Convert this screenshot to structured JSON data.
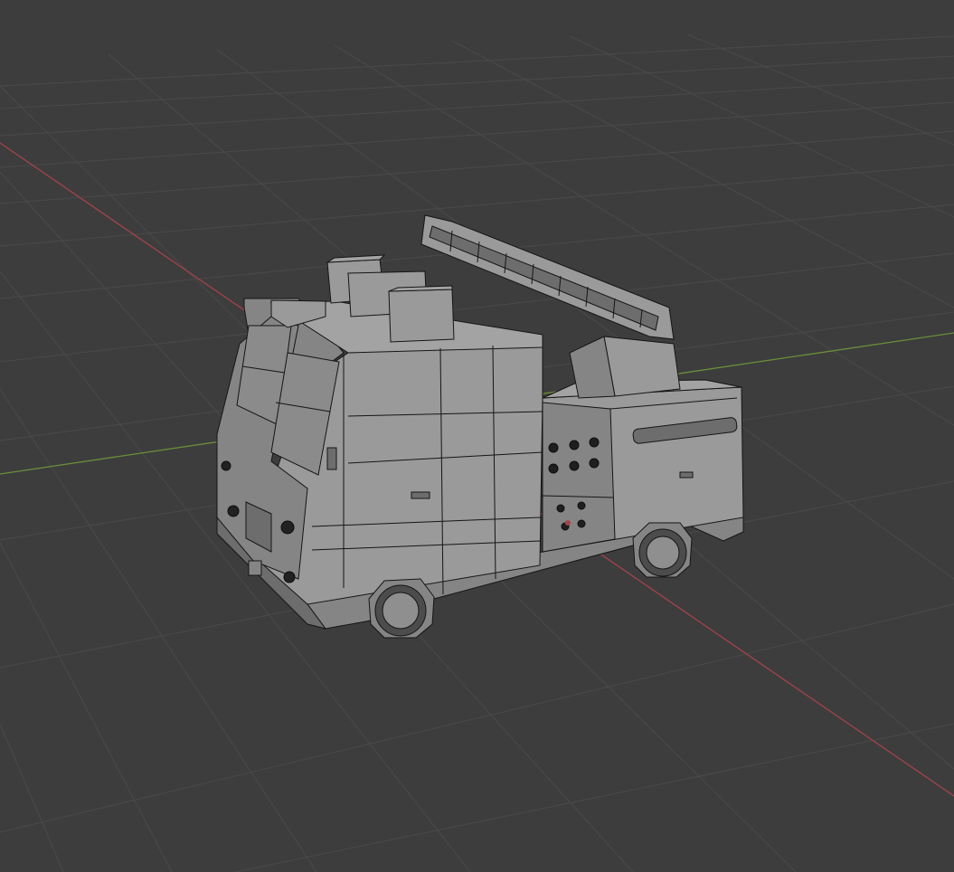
{
  "viewport": {
    "background_color": "#3d3d3d",
    "grid_color": "#4a4a4a",
    "x_axis_color": "#a6434a",
    "y_axis_color": "#6b8f3a",
    "mesh_color": "#8f8f8f",
    "wire_color": "#151515",
    "object": "fire-truck-model"
  }
}
